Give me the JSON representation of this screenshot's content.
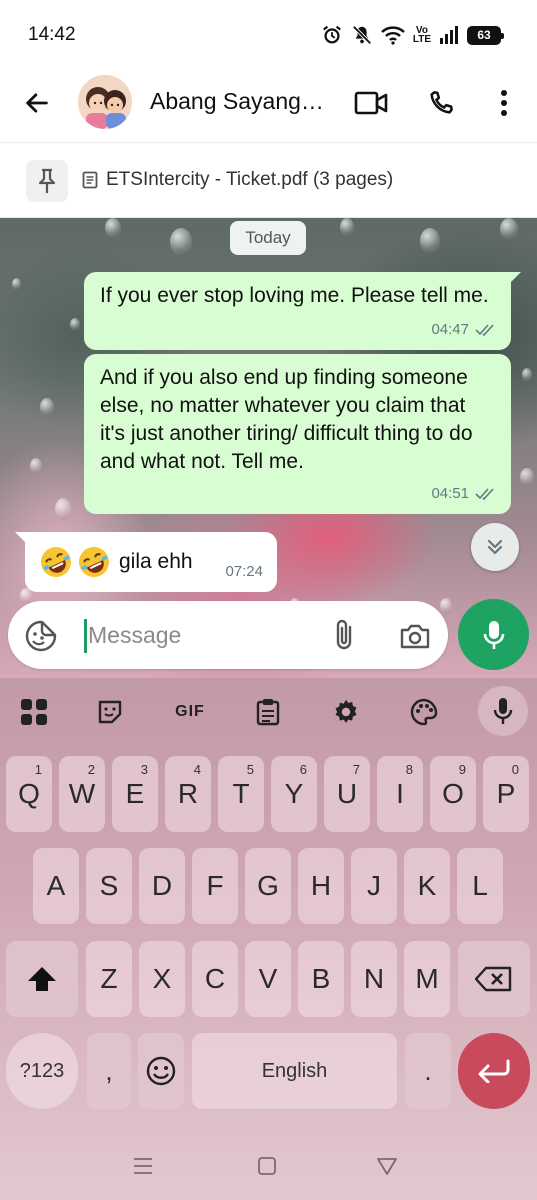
{
  "status_bar": {
    "time": "14:42",
    "network_label_top": "Vo",
    "network_label_bottom": "LTE",
    "battery": "63",
    "icons": [
      "alarm-icon",
      "mute-icon",
      "wifi-icon",
      "volte-icon",
      "signal-icon",
      "battery-icon"
    ]
  },
  "header": {
    "contact_name": "Abang Sayang…",
    "icons": [
      "back-arrow-icon",
      "video-call-icon",
      "phone-icon",
      "more-vert-icon"
    ]
  },
  "pinned": {
    "text": "ETSIntercity - Ticket.pdf (3 pages)",
    "icons": [
      "pin-icon",
      "document-icon"
    ]
  },
  "chat": {
    "date_chip": "Today",
    "messages": [
      {
        "direction": "outgoing",
        "text": "If you ever stop loving me. Please tell me.",
        "time": "04:47",
        "status": "read"
      },
      {
        "direction": "outgoing",
        "text": "And if you also end up finding someone else, no matter whatever you claim that it's just another tiring/ difficult thing to do and what not. Tell me.",
        "time": "04:51",
        "status": "read"
      },
      {
        "direction": "incoming",
        "text": "gila ehh",
        "emojis": [
          "rolling-laughing-emoji",
          "rolling-laughing-emoji"
        ],
        "time": "07:24"
      }
    ]
  },
  "composer": {
    "placeholder": "Message",
    "value": ""
  },
  "keyboard": {
    "toolbar": [
      "apps-grid-icon",
      "sticker-icon",
      "GIF",
      "clipboard-icon",
      "settings-gear-icon",
      "palette-icon",
      "mic-icon"
    ],
    "gif_label": "GIF",
    "row1": [
      {
        "k": "Q",
        "h": "1"
      },
      {
        "k": "W",
        "h": "2"
      },
      {
        "k": "E",
        "h": "3"
      },
      {
        "k": "R",
        "h": "4"
      },
      {
        "k": "T",
        "h": "5"
      },
      {
        "k": "Y",
        "h": "6"
      },
      {
        "k": "U",
        "h": "7"
      },
      {
        "k": "I",
        "h": "8"
      },
      {
        "k": "O",
        "h": "9"
      },
      {
        "k": "P",
        "h": "0"
      }
    ],
    "row2": [
      "A",
      "S",
      "D",
      "F",
      "G",
      "H",
      "J",
      "K",
      "L"
    ],
    "row3": [
      "Z",
      "X",
      "C",
      "V",
      "B",
      "N",
      "M"
    ],
    "symbols_label": "?123",
    "comma": ",",
    "space_label": "English",
    "period": "."
  },
  "colors": {
    "accent_green": "#1ea362",
    "outgoing_bubble": "#d9fdd3",
    "enter_key": "#c9495d"
  }
}
